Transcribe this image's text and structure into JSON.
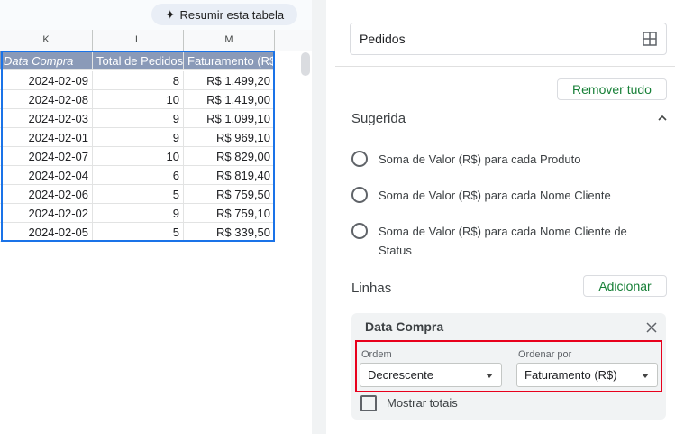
{
  "toolbar": {
    "summarize_label": "Resumir esta tabela"
  },
  "sheet": {
    "columns": [
      "K",
      "L",
      "M"
    ],
    "headers": [
      "Data Compra",
      "Total de Pedidos",
      "Faturamento (R$"
    ],
    "rows": [
      [
        "2024-02-09",
        "8",
        "R$ 1.499,20"
      ],
      [
        "2024-02-08",
        "10",
        "R$ 1.419,00"
      ],
      [
        "2024-02-03",
        "9",
        "R$ 1.099,10"
      ],
      [
        "2024-02-01",
        "9",
        "R$ 969,10"
      ],
      [
        "2024-02-07",
        "10",
        "R$ 829,00"
      ],
      [
        "2024-02-04",
        "6",
        "R$ 819,40"
      ],
      [
        "2024-02-06",
        "5",
        "R$ 759,50"
      ],
      [
        "2024-02-02",
        "9",
        "R$ 759,10"
      ],
      [
        "2024-02-05",
        "5",
        "R$ 339,50"
      ]
    ]
  },
  "panel": {
    "range_value": "Pedidos",
    "remove_all_label": "Remover tudo",
    "suggested_title": "Sugerida",
    "suggestions": [
      "Soma de Valor (R$) para cada Produto",
      "Soma de Valor (R$) para cada Nome Cliente",
      "Soma de Valor (R$) para cada Nome Cliente de Status"
    ],
    "rows_title": "Linhas",
    "add_label": "Adicionar",
    "row_card": {
      "title": "Data Compra",
      "order_label": "Ordem",
      "order_value": "Decrescente",
      "sort_by_label": "Ordenar por",
      "sort_by_value": "Faturamento (R$)",
      "show_totals_label": "Mostrar totais"
    }
  },
  "colors": {
    "header_fill": "#8a9ab8",
    "selection": "#1a73e8",
    "accent_green": "#188038",
    "highlight_red": "#e8001c"
  }
}
